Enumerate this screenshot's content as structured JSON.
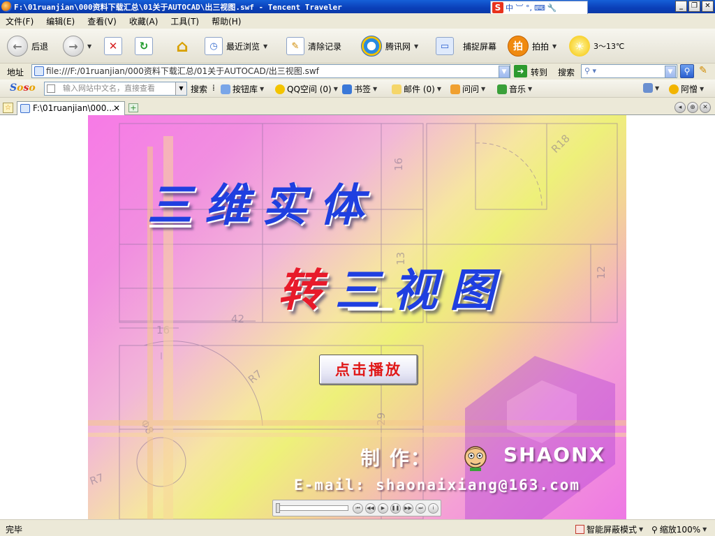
{
  "window": {
    "title": "F:\\01ruanjian\\000资料下载汇总\\01关于AUTOCAD\\出三视图.swf - Tencent Traveler",
    "ime_text": "中 ︺ °,",
    "ime_logo": "S"
  },
  "menu": [
    "文件(F)",
    "编辑(E)",
    "查看(V)",
    "收藏(A)",
    "工具(T)",
    "帮助(H)"
  ],
  "toolbar": {
    "back": "后退",
    "recent": "最近浏览",
    "clear": "清除记录",
    "tencent": "腾讯网",
    "capture": "捕捉屏幕",
    "paipai": "拍拍",
    "paipai_icon": "拍",
    "weather": "3～13℃"
  },
  "address": {
    "label": "地址",
    "url": "file:///F:/01ruanjian/000资料下载汇总/01关于AUTOCAD/出三视图.swf",
    "goto": "转到",
    "search_label": "搜索"
  },
  "soso": {
    "logo_parts": [
      "S",
      "o",
      "s",
      "o"
    ],
    "placeholder": "输入网站中文名，直接查看",
    "search": "搜索",
    "items": [
      "按钮库",
      "QQ空间 (0)",
      "书签",
      "邮件 (0)",
      "问问",
      "音乐"
    ],
    "ask": "阿憎"
  },
  "tab": {
    "label": "F:\\01ruanjian\\000..."
  },
  "flash": {
    "title_line1": "三维实体",
    "title_line2_red": "转",
    "title_line2_rest": "三视图",
    "play_button": "点击播放",
    "credit_label": "制 作：",
    "credit_name": "SHAONX",
    "email": "E-mail: shaonaixiang@163.com",
    "dims": [
      "16",
      "R18",
      "42",
      "16",
      "13",
      "12",
      "R7",
      "29",
      "Φ8",
      "R7"
    ]
  },
  "status": {
    "text": "完毕",
    "mode": "智能屏蔽模式",
    "zoom": "缩放100%"
  }
}
